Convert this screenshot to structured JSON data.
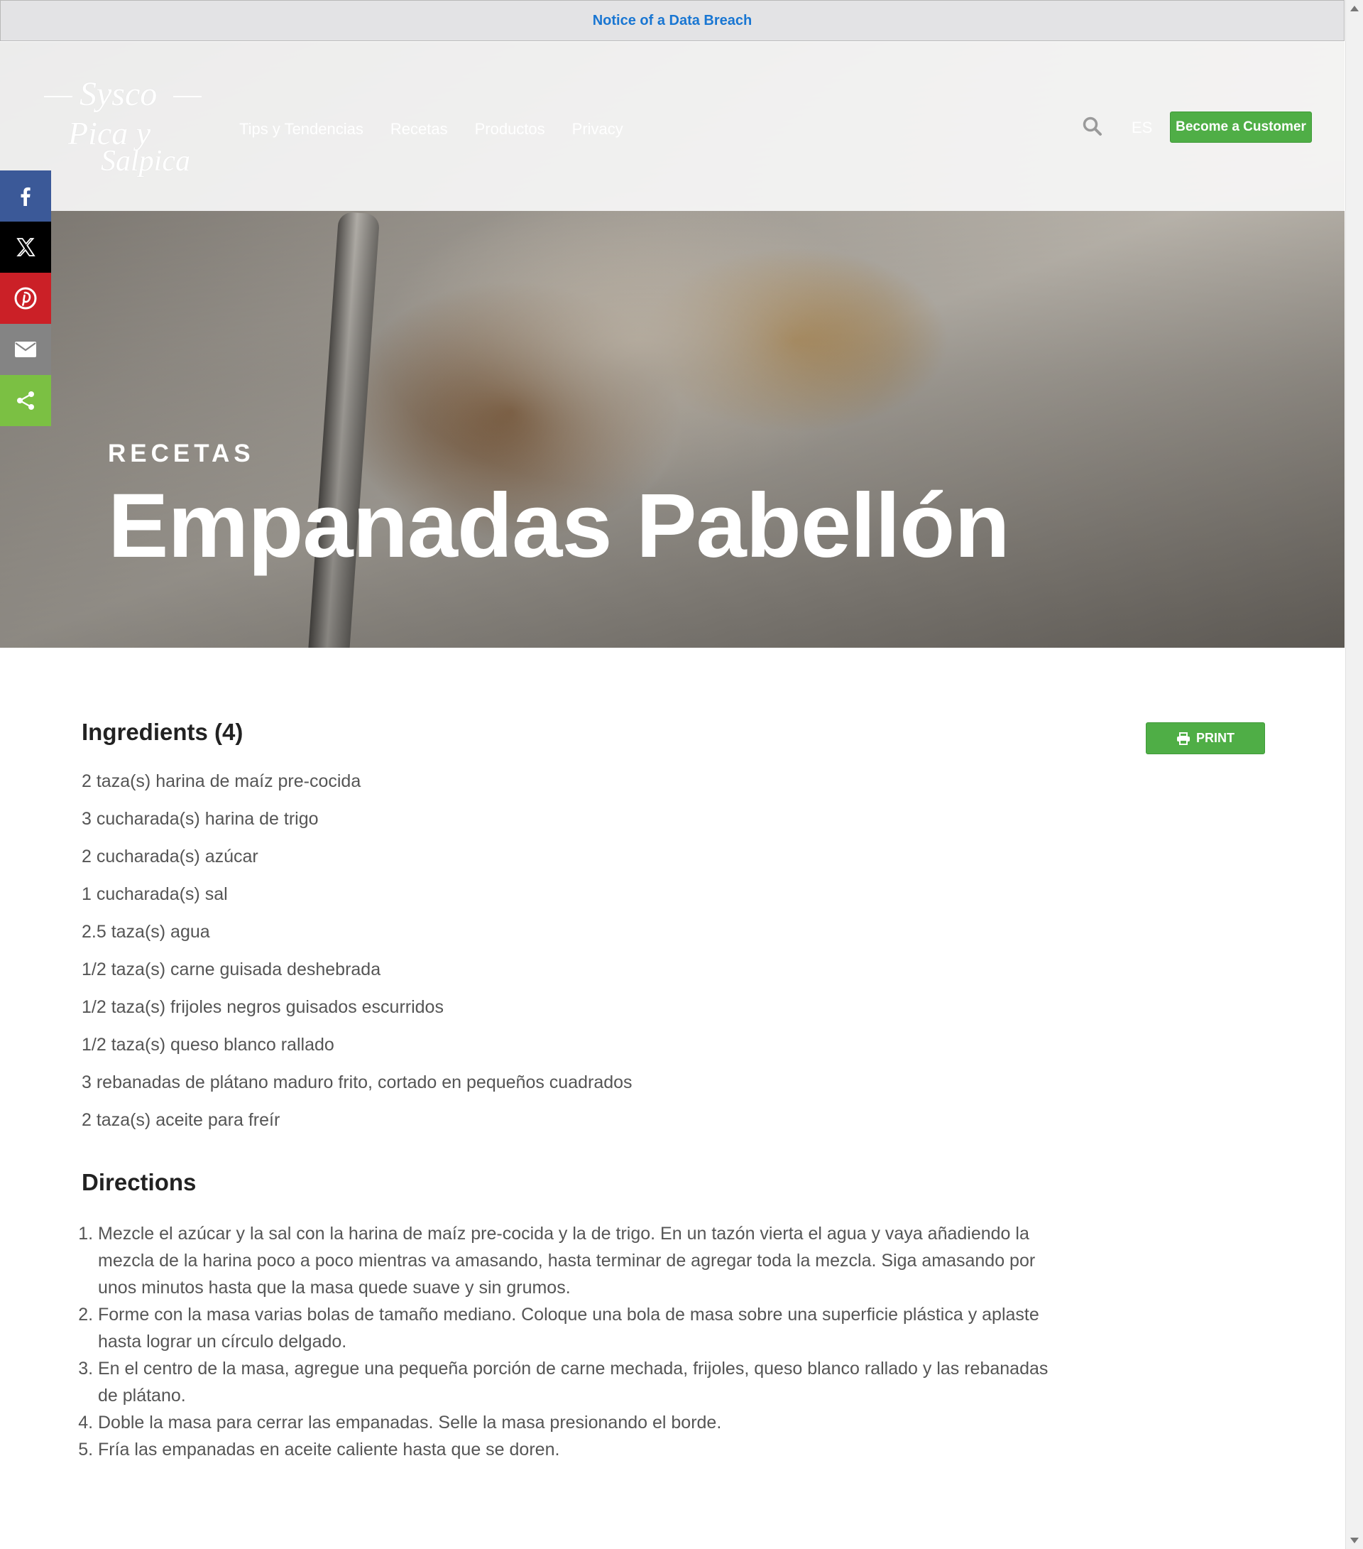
{
  "notice": {
    "link_label": "Notice of a Data Breach"
  },
  "header": {
    "logo": {
      "line1": "Sysco",
      "line2": "Pica y",
      "line3": "Salpica"
    },
    "nav": [
      "Tips y Tendencias",
      "Recetas",
      "Productos",
      "Privacy"
    ],
    "language": "ES",
    "cta_label": "Become a Customer"
  },
  "hero": {
    "eyebrow": "RECETAS",
    "title": "Empanadas Pabellón"
  },
  "share": {
    "items": [
      {
        "icon": "facebook-icon",
        "color": "#3b5998"
      },
      {
        "icon": "x-icon",
        "color": "#000000"
      },
      {
        "icon": "pinterest-icon",
        "color": "#cb2027"
      },
      {
        "icon": "email-icon",
        "color": "#848484"
      },
      {
        "icon": "share-icon",
        "color": "#7bc043"
      }
    ]
  },
  "ingredients": {
    "heading": "Ingredients (4)",
    "items": [
      "2 taza(s) harina de maíz pre-cocida",
      "3 cucharada(s) harina de trigo",
      "2 cucharada(s) azúcar",
      "1 cucharada(s) sal",
      "2.5 taza(s) agua",
      "1/2 taza(s) carne guisada deshebrada",
      "1/2 taza(s) frijoles negros guisados escurridos",
      "1/2 taza(s) queso blanco rallado",
      "3 rebanadas de plátano maduro frito, cortado en pequeños cuadrados",
      "2 taza(s) aceite para freír"
    ]
  },
  "print_label": "PRINT",
  "directions": {
    "heading": "Directions",
    "steps": [
      "Mezcle el azúcar y la sal con la harina de maíz pre-cocida y la de trigo. En un tazón vierta el agua y vaya añadiendo la mezcla de la harina poco a poco mientras va amasando, hasta terminar de agregar toda la mezcla. Siga amasando por unos minutos hasta que la masa quede suave y sin grumos.",
      "Forme con la masa varias bolas de tamaño mediano. Coloque una bola de masa sobre una superficie plástica y aplaste hasta lograr un círculo delgado.",
      "En el centro de la masa, agregue una pequeña porción de carne mechada, frijoles, queso blanco rallado y las rebanadas de plátano.",
      "Doble la masa para cerrar las empanadas. Selle la masa presionando el borde.",
      "Fría las empanadas en aceite caliente hasta que se doren."
    ]
  },
  "colors": {
    "accent": "#4fae46",
    "link": "#1976d2"
  }
}
